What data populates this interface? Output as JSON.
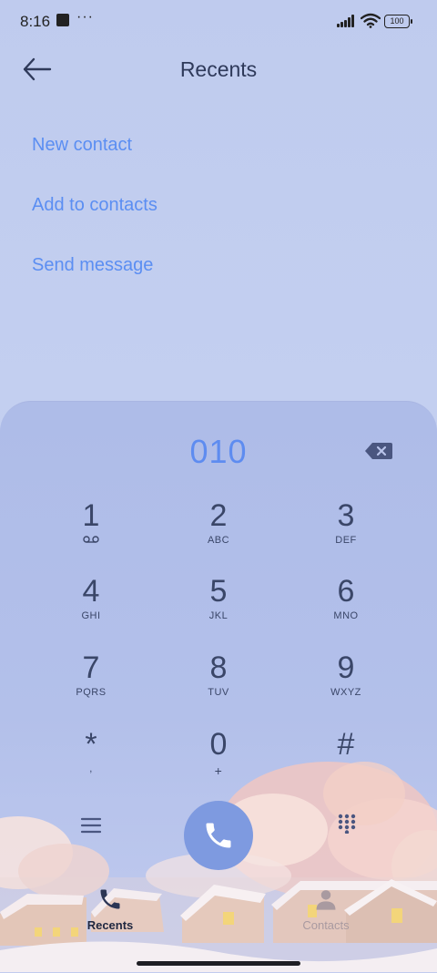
{
  "status_bar": {
    "time": "8:16",
    "more": "···",
    "battery": "100"
  },
  "header": {
    "title": "Recents"
  },
  "actions": {
    "new_contact": "New contact",
    "add_to_contacts": "Add to contacts",
    "send_message": "Send message"
  },
  "dialer": {
    "number": "010",
    "keys": [
      {
        "digit": "1",
        "letters": ""
      },
      {
        "digit": "2",
        "letters": "ABC"
      },
      {
        "digit": "3",
        "letters": "DEF"
      },
      {
        "digit": "4",
        "letters": "GHI"
      },
      {
        "digit": "5",
        "letters": "JKL"
      },
      {
        "digit": "6",
        "letters": "MNO"
      },
      {
        "digit": "7",
        "letters": "PQRS"
      },
      {
        "digit": "8",
        "letters": "TUV"
      },
      {
        "digit": "9",
        "letters": "WXYZ"
      },
      {
        "digit": "*",
        "letters": ","
      },
      {
        "digit": "0",
        "letters": "+"
      },
      {
        "digit": "#",
        "letters": ""
      }
    ]
  },
  "bottom_nav": {
    "recents": "Recents",
    "contacts": "Contacts"
  },
  "colors": {
    "accent": "#5b8ef2",
    "call_button": "#7e9ae0",
    "text": "#3a4668"
  },
  "icons": {
    "back": "arrow-left-icon",
    "voicemail": "voicemail-icon",
    "backspace": "backspace-icon",
    "menu": "menu-icon",
    "call": "phone-icon",
    "keypad": "dialpad-icon",
    "recents_tab": "phone-icon",
    "contacts_tab": "person-icon"
  }
}
